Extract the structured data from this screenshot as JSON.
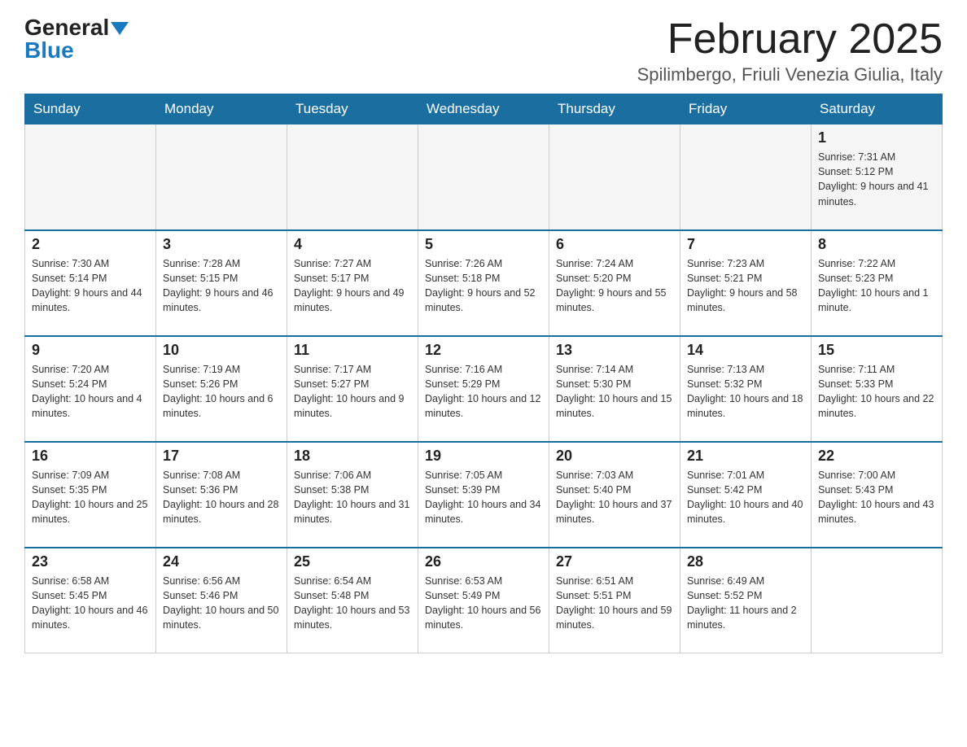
{
  "header": {
    "logo_general": "General",
    "logo_blue": "Blue",
    "title": "February 2025",
    "subtitle": "Spilimbergo, Friuli Venezia Giulia, Italy"
  },
  "days_of_week": [
    "Sunday",
    "Monday",
    "Tuesday",
    "Wednesday",
    "Thursday",
    "Friday",
    "Saturday"
  ],
  "weeks": [
    [
      {
        "day": "",
        "sunrise": "",
        "sunset": "",
        "daylight": ""
      },
      {
        "day": "",
        "sunrise": "",
        "sunset": "",
        "daylight": ""
      },
      {
        "day": "",
        "sunrise": "",
        "sunset": "",
        "daylight": ""
      },
      {
        "day": "",
        "sunrise": "",
        "sunset": "",
        "daylight": ""
      },
      {
        "day": "",
        "sunrise": "",
        "sunset": "",
        "daylight": ""
      },
      {
        "day": "",
        "sunrise": "",
        "sunset": "",
        "daylight": ""
      },
      {
        "day": "1",
        "sunrise": "Sunrise: 7:31 AM",
        "sunset": "Sunset: 5:12 PM",
        "daylight": "Daylight: 9 hours and 41 minutes."
      }
    ],
    [
      {
        "day": "2",
        "sunrise": "Sunrise: 7:30 AM",
        "sunset": "Sunset: 5:14 PM",
        "daylight": "Daylight: 9 hours and 44 minutes."
      },
      {
        "day": "3",
        "sunrise": "Sunrise: 7:28 AM",
        "sunset": "Sunset: 5:15 PM",
        "daylight": "Daylight: 9 hours and 46 minutes."
      },
      {
        "day": "4",
        "sunrise": "Sunrise: 7:27 AM",
        "sunset": "Sunset: 5:17 PM",
        "daylight": "Daylight: 9 hours and 49 minutes."
      },
      {
        "day": "5",
        "sunrise": "Sunrise: 7:26 AM",
        "sunset": "Sunset: 5:18 PM",
        "daylight": "Daylight: 9 hours and 52 minutes."
      },
      {
        "day": "6",
        "sunrise": "Sunrise: 7:24 AM",
        "sunset": "Sunset: 5:20 PM",
        "daylight": "Daylight: 9 hours and 55 minutes."
      },
      {
        "day": "7",
        "sunrise": "Sunrise: 7:23 AM",
        "sunset": "Sunset: 5:21 PM",
        "daylight": "Daylight: 9 hours and 58 minutes."
      },
      {
        "day": "8",
        "sunrise": "Sunrise: 7:22 AM",
        "sunset": "Sunset: 5:23 PM",
        "daylight": "Daylight: 10 hours and 1 minute."
      }
    ],
    [
      {
        "day": "9",
        "sunrise": "Sunrise: 7:20 AM",
        "sunset": "Sunset: 5:24 PM",
        "daylight": "Daylight: 10 hours and 4 minutes."
      },
      {
        "day": "10",
        "sunrise": "Sunrise: 7:19 AM",
        "sunset": "Sunset: 5:26 PM",
        "daylight": "Daylight: 10 hours and 6 minutes."
      },
      {
        "day": "11",
        "sunrise": "Sunrise: 7:17 AM",
        "sunset": "Sunset: 5:27 PM",
        "daylight": "Daylight: 10 hours and 9 minutes."
      },
      {
        "day": "12",
        "sunrise": "Sunrise: 7:16 AM",
        "sunset": "Sunset: 5:29 PM",
        "daylight": "Daylight: 10 hours and 12 minutes."
      },
      {
        "day": "13",
        "sunrise": "Sunrise: 7:14 AM",
        "sunset": "Sunset: 5:30 PM",
        "daylight": "Daylight: 10 hours and 15 minutes."
      },
      {
        "day": "14",
        "sunrise": "Sunrise: 7:13 AM",
        "sunset": "Sunset: 5:32 PM",
        "daylight": "Daylight: 10 hours and 18 minutes."
      },
      {
        "day": "15",
        "sunrise": "Sunrise: 7:11 AM",
        "sunset": "Sunset: 5:33 PM",
        "daylight": "Daylight: 10 hours and 22 minutes."
      }
    ],
    [
      {
        "day": "16",
        "sunrise": "Sunrise: 7:09 AM",
        "sunset": "Sunset: 5:35 PM",
        "daylight": "Daylight: 10 hours and 25 minutes."
      },
      {
        "day": "17",
        "sunrise": "Sunrise: 7:08 AM",
        "sunset": "Sunset: 5:36 PM",
        "daylight": "Daylight: 10 hours and 28 minutes."
      },
      {
        "day": "18",
        "sunrise": "Sunrise: 7:06 AM",
        "sunset": "Sunset: 5:38 PM",
        "daylight": "Daylight: 10 hours and 31 minutes."
      },
      {
        "day": "19",
        "sunrise": "Sunrise: 7:05 AM",
        "sunset": "Sunset: 5:39 PM",
        "daylight": "Daylight: 10 hours and 34 minutes."
      },
      {
        "day": "20",
        "sunrise": "Sunrise: 7:03 AM",
        "sunset": "Sunset: 5:40 PM",
        "daylight": "Daylight: 10 hours and 37 minutes."
      },
      {
        "day": "21",
        "sunrise": "Sunrise: 7:01 AM",
        "sunset": "Sunset: 5:42 PM",
        "daylight": "Daylight: 10 hours and 40 minutes."
      },
      {
        "day": "22",
        "sunrise": "Sunrise: 7:00 AM",
        "sunset": "Sunset: 5:43 PM",
        "daylight": "Daylight: 10 hours and 43 minutes."
      }
    ],
    [
      {
        "day": "23",
        "sunrise": "Sunrise: 6:58 AM",
        "sunset": "Sunset: 5:45 PM",
        "daylight": "Daylight: 10 hours and 46 minutes."
      },
      {
        "day": "24",
        "sunrise": "Sunrise: 6:56 AM",
        "sunset": "Sunset: 5:46 PM",
        "daylight": "Daylight: 10 hours and 50 minutes."
      },
      {
        "day": "25",
        "sunrise": "Sunrise: 6:54 AM",
        "sunset": "Sunset: 5:48 PM",
        "daylight": "Daylight: 10 hours and 53 minutes."
      },
      {
        "day": "26",
        "sunrise": "Sunrise: 6:53 AM",
        "sunset": "Sunset: 5:49 PM",
        "daylight": "Daylight: 10 hours and 56 minutes."
      },
      {
        "day": "27",
        "sunrise": "Sunrise: 6:51 AM",
        "sunset": "Sunset: 5:51 PM",
        "daylight": "Daylight: 10 hours and 59 minutes."
      },
      {
        "day": "28",
        "sunrise": "Sunrise: 6:49 AM",
        "sunset": "Sunset: 5:52 PM",
        "daylight": "Daylight: 11 hours and 2 minutes."
      },
      {
        "day": "",
        "sunrise": "",
        "sunset": "",
        "daylight": ""
      }
    ]
  ]
}
